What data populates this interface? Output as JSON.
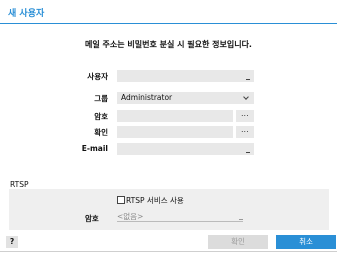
{
  "dialog": {
    "title": "새 사용자",
    "notice": "메일 주소는 비밀번호 분실 시 필요한 정보입니다."
  },
  "form": {
    "username_label": "사용자",
    "username_value": "",
    "group_label": "그룹",
    "group_value": "Administrator",
    "password_label": "암호",
    "password_dots": "...",
    "confirm_label": "확인",
    "confirm_dots": "...",
    "email_label": "E-mail",
    "email_value": ""
  },
  "rtsp": {
    "section_label": "RTSP",
    "use_checkbox_label": "RTSP 서비스 사용",
    "use_checked": false,
    "password_label": "암호",
    "password_placeholder": "<없음>"
  },
  "buttons": {
    "help_label": "?",
    "ok_label": "확인",
    "cancel_label": "취소"
  },
  "colors": {
    "accent": "#2a8fd6",
    "disabled_text": "#9a9a9a"
  }
}
